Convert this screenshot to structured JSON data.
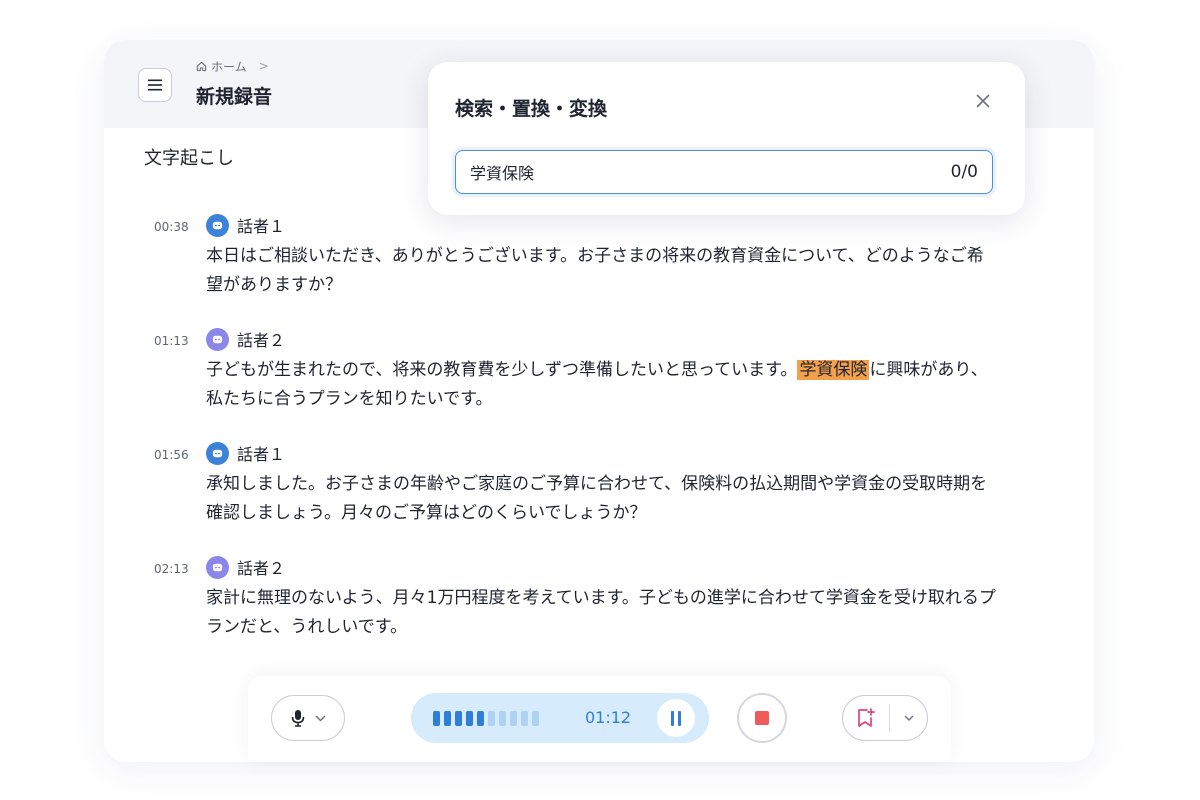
{
  "header": {
    "breadcrumb": {
      "home_label": "ホーム",
      "separator": ">"
    },
    "title": "新規録音"
  },
  "section_title": "文字起こし",
  "transcript": [
    {
      "time": "00:38",
      "speaker": "話者１",
      "text": "本日はご相談いただき、ありがとうございます。お子さまの将来の教育資金について、どのようなご希望がありますか？"
    },
    {
      "time": "01:13",
      "speaker": "話者２",
      "text_before": "子どもが生まれたので、将来の教育費を少しずつ準備したいと思っています。",
      "highlight": "学資保険",
      "text_after": "に興味があり、私たちに合うプランを知りたいです。"
    },
    {
      "time": "01:56",
      "speaker": "話者１",
      "text": "承知しました。お子さまの年齢やご家庭のご予算に合わせて、保険料の払込期間や学資金の受取時期を確認しましょう。月々のご予算はどのくらいでしょうか？"
    },
    {
      "time": "02:13",
      "speaker": "話者２",
      "text": "家計に無理のないよう、月々1万円程度を考えています。子どもの進学に合わせて学資金を受け取れるプランだと、うれしいです。"
    }
  ],
  "search_dialog": {
    "title": "検索・置換・変換",
    "query": "学資保険",
    "match_count": "0/0"
  },
  "toolbar": {
    "record_time": "01:12",
    "level_active_fraction": 0.5
  },
  "colors": {
    "highlight": "#f2a04a",
    "accent": "#2f7fd6",
    "speaker1_avatar": "#3b82d8",
    "speaker2_avatar": "#8b87e8",
    "stop": "#ef5a5a"
  },
  "icons": {
    "menu": "hamburger-icon",
    "home": "home-icon",
    "close": "close-icon",
    "mic": "microphone-icon",
    "pause": "pause-icon",
    "stop": "stop-icon",
    "bookmark": "bookmark-add-icon",
    "dropdown": "chevron-down-icon"
  }
}
